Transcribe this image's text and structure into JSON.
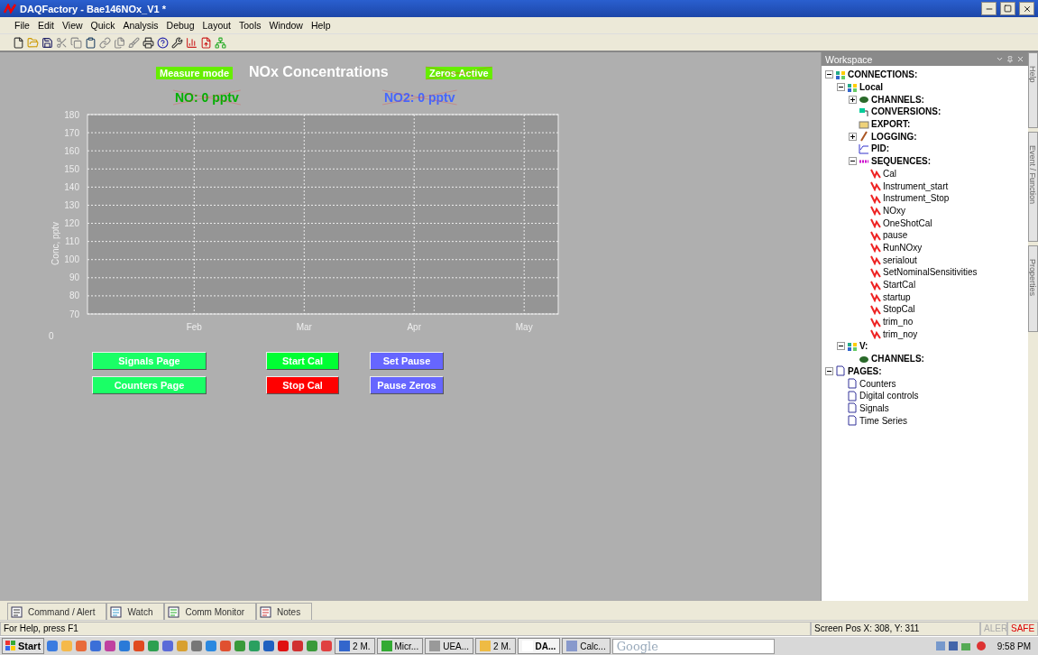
{
  "window": {
    "title": "DAQFactory - Bae146NOx_V1 *"
  },
  "menu": [
    "File",
    "Edit",
    "View",
    "Quick",
    "Analysis",
    "Debug",
    "Layout",
    "Tools",
    "Window",
    "Help"
  ],
  "page": {
    "title": "NOx Concentrations",
    "indicators": [
      {
        "label": "Measure mode",
        "crossed": false,
        "kind": "badge"
      },
      {
        "label": "Zeros Active",
        "crossed": true,
        "kind": "badge"
      },
      {
        "label": "NO: 0 pptv",
        "crossed": true,
        "kind": "reading",
        "color": "#00b000"
      },
      {
        "label": "NO2: 0 pptv",
        "crossed": true,
        "kind": "reading",
        "color": "#4466ff"
      }
    ],
    "chart_data": {
      "type": "line",
      "grid": true,
      "ylabel": "Conc, pptv",
      "ylim": [
        70,
        180
      ],
      "yticks": [
        70,
        80,
        90,
        100,
        110,
        120,
        130,
        140,
        150,
        160,
        170,
        180
      ],
      "categories": [
        "Feb",
        "Mar",
        "Apr",
        "May"
      ]
    },
    "corner_label": "0",
    "buttons": [
      {
        "label": "Signals Page",
        "color": "#1aff66"
      },
      {
        "label": "Counters Page",
        "color": "#1aff66"
      },
      {
        "label": "Start Cal",
        "color": "#00ff33"
      },
      {
        "label": "Stop Cal",
        "color": "#ff0000"
      },
      {
        "label": "Set Pause",
        "color": "#6666ff"
      },
      {
        "label": "Pause Zeros",
        "color": "#6666ff"
      }
    ]
  },
  "workspace": {
    "title": "Workspace",
    "tree": [
      {
        "label": "CONNECTIONS:",
        "kind": "connection",
        "expanded": true,
        "children": [
          {
            "label": "Local",
            "kind": "connection",
            "expanded": true,
            "children": [
              {
                "label": "CHANNELS:",
                "kind": "channels",
                "expanded": false
              },
              {
                "label": "CONVERSIONS:",
                "kind": "conversions"
              },
              {
                "label": "EXPORT:",
                "kind": "export"
              },
              {
                "label": "LOGGING:",
                "kind": "logging",
                "expanded": false
              },
              {
                "label": "PID:",
                "kind": "pid"
              },
              {
                "label": "SEQUENCES:",
                "kind": "sequences",
                "expanded": true,
                "children": [
                  {
                    "label": "Cal",
                    "kind": "sequence"
                  },
                  {
                    "label": "Instrument_start",
                    "kind": "sequence"
                  },
                  {
                    "label": "Instrument_Stop",
                    "kind": "sequence"
                  },
                  {
                    "label": "NOxy",
                    "kind": "sequence"
                  },
                  {
                    "label": "OneShotCal",
                    "kind": "sequence"
                  },
                  {
                    "label": "pause",
                    "kind": "sequence"
                  },
                  {
                    "label": "RunNOxy",
                    "kind": "sequence"
                  },
                  {
                    "label": "serialout",
                    "kind": "sequence"
                  },
                  {
                    "label": "SetNominalSensitivities",
                    "kind": "sequence"
                  },
                  {
                    "label": "StartCal",
                    "kind": "sequence"
                  },
                  {
                    "label": "startup",
                    "kind": "sequence"
                  },
                  {
                    "label": "StopCal",
                    "kind": "sequence"
                  },
                  {
                    "label": "trim_no",
                    "kind": "sequence"
                  },
                  {
                    "label": "trim_noy",
                    "kind": "sequence"
                  }
                ]
              }
            ]
          },
          {
            "label": "V:",
            "kind": "connection",
            "expanded": true,
            "children": [
              {
                "label": "CHANNELS:",
                "kind": "channels"
              }
            ]
          }
        ]
      },
      {
        "label": "PAGES:",
        "kind": "pages",
        "expanded": true,
        "children": [
          {
            "label": "Counters",
            "kind": "page"
          },
          {
            "label": "Digital controls",
            "kind": "page"
          },
          {
            "label": "Signals",
            "kind": "page"
          },
          {
            "label": "Time Series",
            "kind": "page"
          }
        ]
      }
    ]
  },
  "side_tabs": [
    "Help",
    "Event / Function",
    "Properties"
  ],
  "bottom_tabs": [
    "Command / Alert",
    "Watch",
    "Comm Monitor",
    "Notes"
  ],
  "status_bar": {
    "help": "For Help, press F1",
    "position": "Screen Pos X: 308, Y: 311",
    "alert": "ALER",
    "safe": "SAFE"
  },
  "taskbar": {
    "start": "Start",
    "windows": [
      {
        "label": "2 M.",
        "selected": false
      },
      {
        "label": "Micr...",
        "selected": false
      },
      {
        "label": "UEA...",
        "selected": false
      },
      {
        "label": "2 M.",
        "selected": false
      },
      {
        "label": "DA...",
        "selected": true
      },
      {
        "label": "Calc...",
        "selected": false
      }
    ],
    "search_placeholder": "Google",
    "clock": "9:58 PM"
  }
}
